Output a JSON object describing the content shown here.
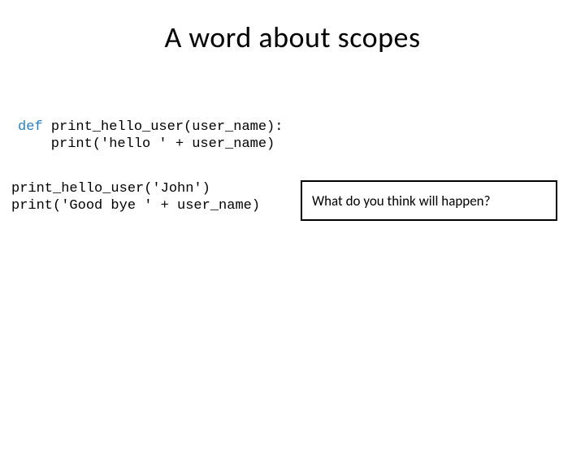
{
  "title": "A word about scopes",
  "code": {
    "defKeyword": "def ",
    "defLine": "print_hello_user(user_name):",
    "bodyLine": "    print('hello ' + user_name)",
    "callLine1": "print_hello_user('John')",
    "callLine2": "print('Good bye ' + user_name)"
  },
  "callout": {
    "text": "What do you think will happen?"
  }
}
